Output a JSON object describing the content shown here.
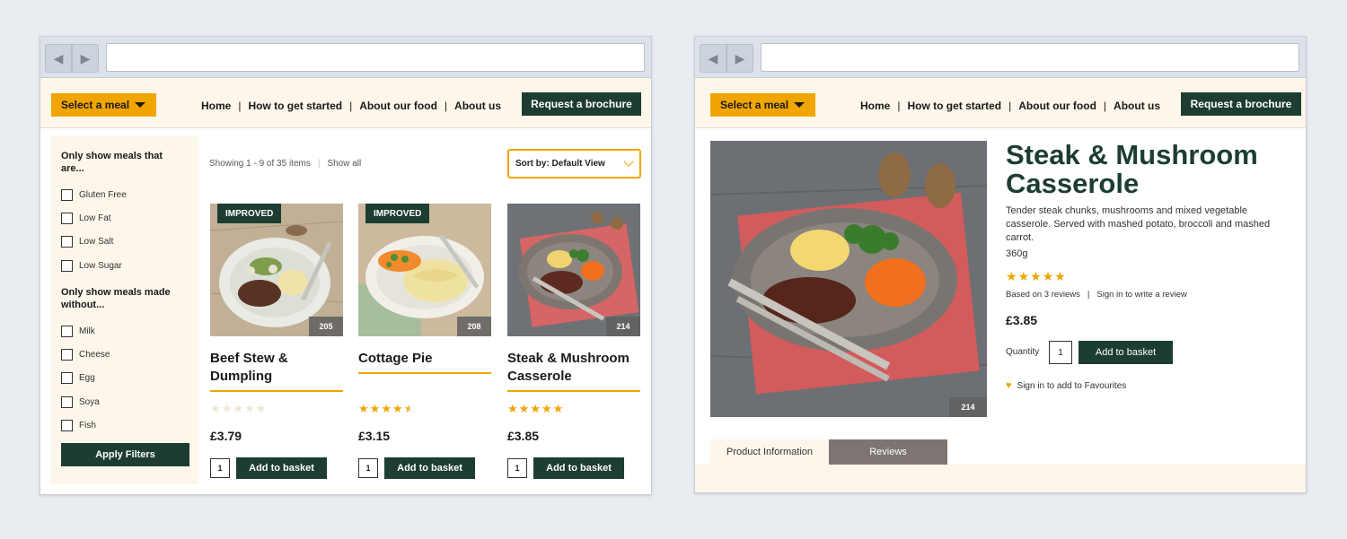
{
  "header": {
    "select_meal": "Select a meal",
    "nav": [
      "Home",
      "How to get started",
      "About our food",
      "About us"
    ],
    "separator": "|",
    "brochure": "Request a brochure"
  },
  "colors": {
    "accent": "#f0a500",
    "brand_dark": "#1d3d32",
    "cream": "#fdf6ea"
  },
  "icons": {
    "back": "chevron-left-icon",
    "forward": "chevron-right-icon",
    "dropdown": "caret-down-icon",
    "favourite": "heart-icon"
  },
  "listing": {
    "filters": {
      "heading_show": "Only show meals that are...",
      "options_show": [
        "Gluten Free",
        "Low Fat",
        "Low Salt",
        "Low Sugar"
      ],
      "heading_without": "Only show meals made without...",
      "options_without": [
        "Milk",
        "Cheese",
        "Egg",
        "Soya",
        "Fish"
      ],
      "apply": "Apply Filters"
    },
    "showing": "Showing 1 - 9 of 35 items",
    "show_all": "Show all",
    "sort": "Sort by: Default View",
    "products": [
      {
        "name": "Beef Stew & Dumpling",
        "badge": "IMPROVED",
        "code": "205",
        "rating": 0,
        "price": "£3.79",
        "qty": "1",
        "add": "Add to basket"
      },
      {
        "name": "Cottage Pie",
        "badge": "IMPROVED",
        "code": "208",
        "rating": 4.5,
        "price": "£3.15",
        "qty": "1",
        "add": "Add to basket"
      },
      {
        "name": "Steak & Mushroom Casserole",
        "badge": "",
        "code": "214",
        "rating": 5,
        "price": "£3.85",
        "qty": "1",
        "add": "Add to basket"
      }
    ]
  },
  "detail": {
    "title": "Steak & Mushroom Casserole",
    "description": "Tender steak chunks, mushrooms and mixed vegetable casserole. Served with mashed potato, broccoli and mashed carrot.",
    "weight": "360g",
    "rating": 5,
    "reviews": "Based on 3 reviews",
    "sign_in_review": "Sign in to write a review",
    "price": "£3.85",
    "quantity_label": "Quantity",
    "qty": "1",
    "add": "Add to basket",
    "favourites": "Sign in to add to Favourites",
    "code": "214",
    "tabs": [
      "Product Information",
      "Reviews"
    ]
  }
}
